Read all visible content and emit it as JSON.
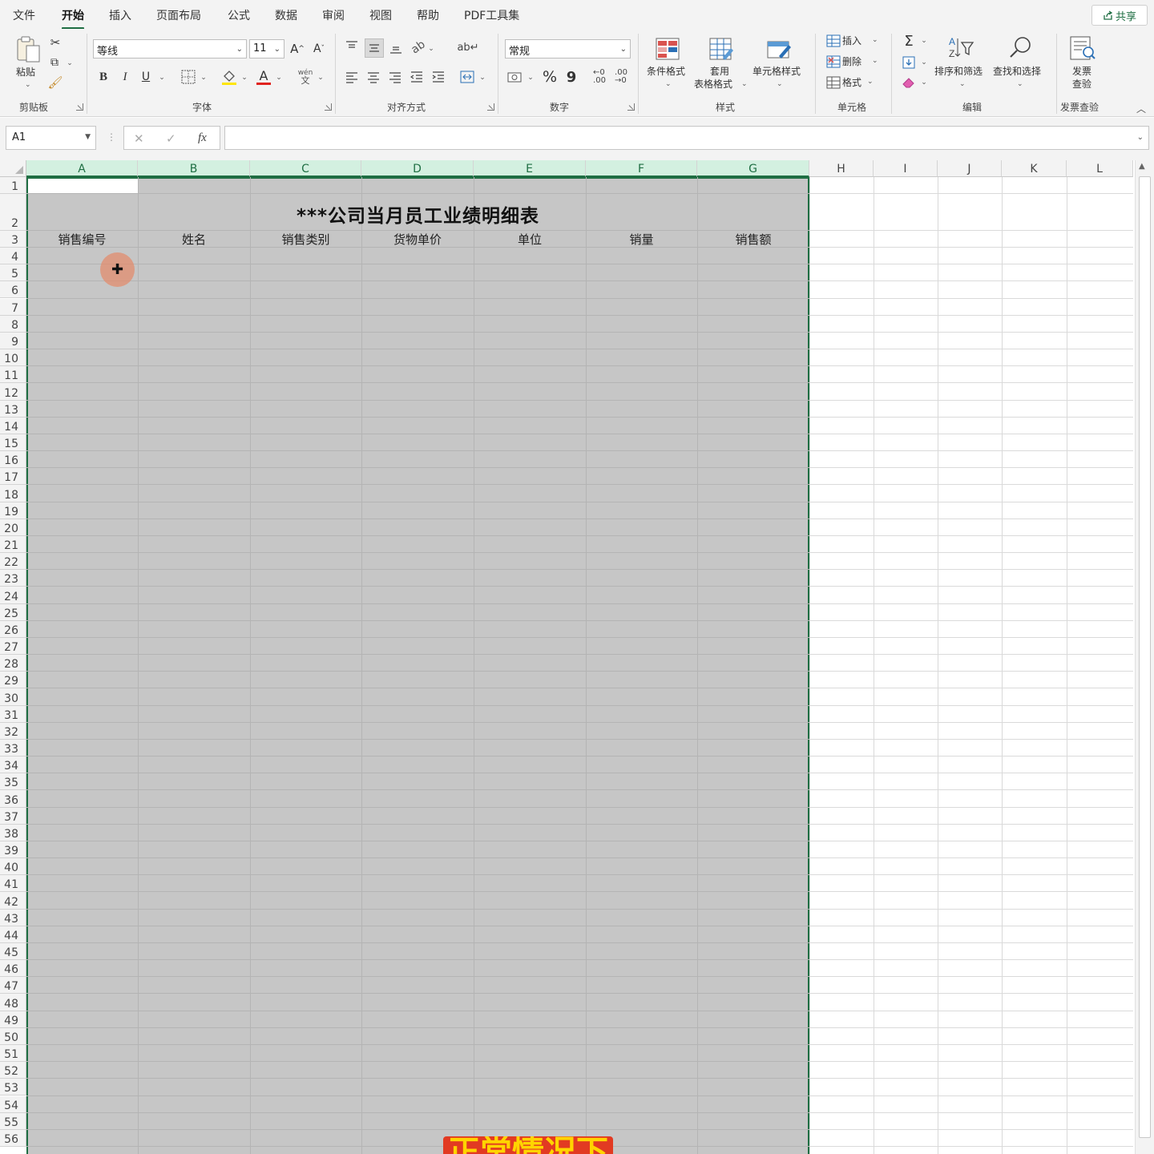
{
  "menu": {
    "tabs": [
      "文件",
      "开始",
      "插入",
      "页面布局",
      "公式",
      "数据",
      "审阅",
      "视图",
      "帮助",
      "PDF工具集"
    ],
    "active": "开始",
    "share_label": "共享"
  },
  "ribbon": {
    "clipboard": {
      "paste": "粘贴",
      "group": "剪贴板"
    },
    "font": {
      "name": "等线",
      "size": "11",
      "group": "字体",
      "bold": "B",
      "italic": "I",
      "underline": "U"
    },
    "alignment": {
      "group": "对齐方式"
    },
    "number": {
      "format": "常规",
      "group": "数字",
      "percent": "%",
      "comma": "9"
    },
    "styles": {
      "conditional": "条件格式",
      "table_1": "套用",
      "table_2": "表格格式",
      "cell_styles": "单元格样式",
      "group": "样式"
    },
    "cells": {
      "insert": "插入",
      "delete": "删除",
      "format": "格式",
      "group": "单元格"
    },
    "editing": {
      "sort": "排序和筛选",
      "find": "查找和选择",
      "group": "编辑"
    },
    "invoice": {
      "label_1": "发票",
      "label_2": "查验",
      "group": "发票查验"
    }
  },
  "formula_bar": {
    "name_box": "A1",
    "fx": "fx",
    "value": ""
  },
  "sheet": {
    "columns": [
      "A",
      "B",
      "C",
      "D",
      "E",
      "F",
      "G",
      "H",
      "I",
      "J",
      "K",
      "L"
    ],
    "rows": [
      "1",
      "2",
      "3",
      "4",
      "5",
      "6",
      "7",
      "8",
      "9",
      "10",
      "11",
      "12",
      "13",
      "14",
      "15",
      "16",
      "17",
      "18",
      "19",
      "20",
      "21",
      "22",
      "23",
      "24",
      "25",
      "26",
      "27",
      "28",
      "29",
      "30",
      "31",
      "32",
      "33",
      "34",
      "35",
      "36",
      "37",
      "38",
      "39",
      "40",
      "41",
      "42",
      "43",
      "44",
      "45",
      "46",
      "47",
      "48",
      "49",
      "50",
      "51",
      "52",
      "53",
      "54",
      "55",
      "56"
    ],
    "title": "***公司当月员工业绩明细表",
    "headers": [
      "销售编号",
      "姓名",
      "销售类别",
      "货物单价",
      "单位",
      "销量",
      "销售额"
    ]
  },
  "caption": "正常情况下"
}
